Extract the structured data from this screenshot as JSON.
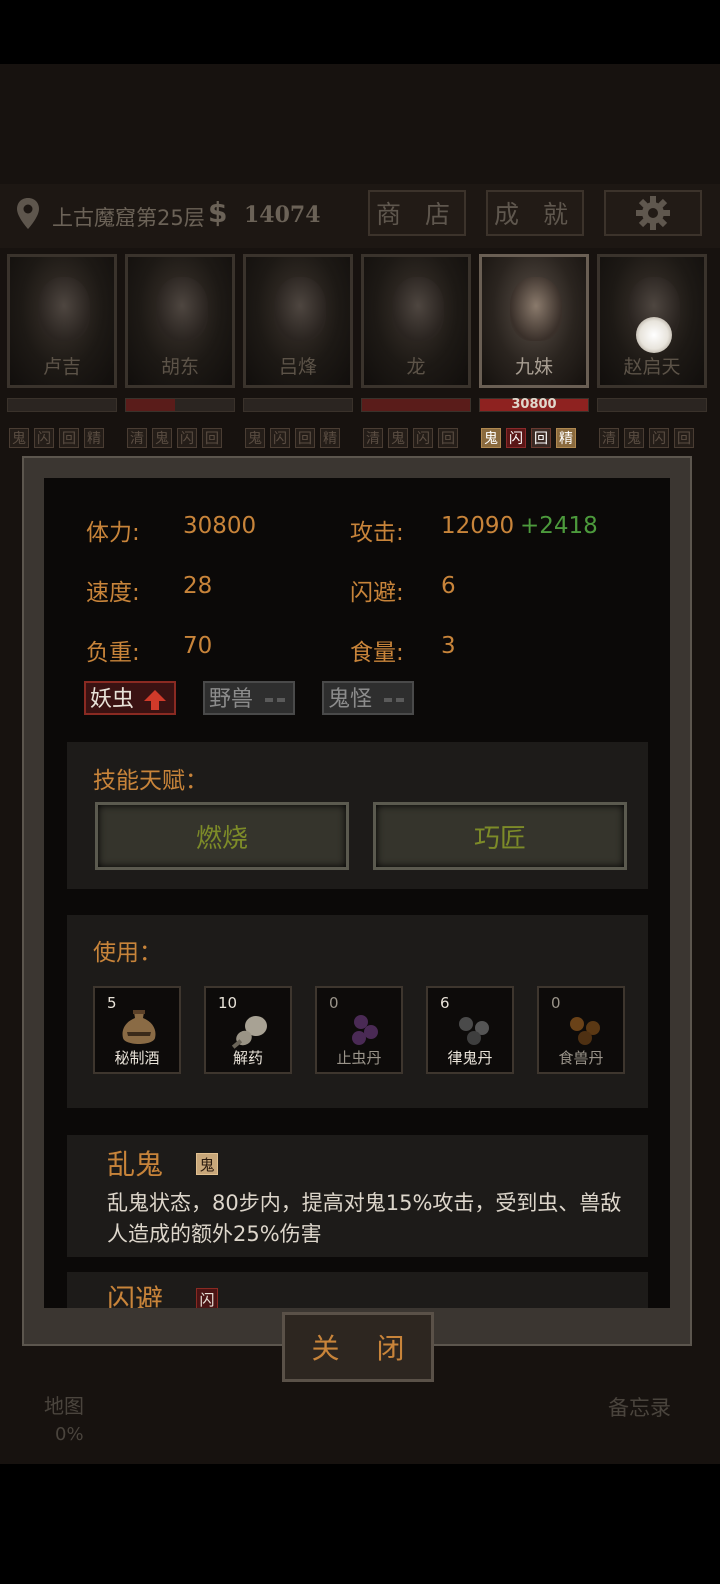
{
  "header": {
    "location": "上古魔窟第25层",
    "money_symbol": "$",
    "money": "14074",
    "shop_label": "商 店",
    "achievements_label": "成 就",
    "settings_icon": "gear-icon"
  },
  "characters": [
    {
      "name": "卢吉",
      "hp_ratio": 0.0,
      "tags": [
        "鬼",
        "闪",
        "回",
        "精"
      ]
    },
    {
      "name": "胡东",
      "hp_ratio": 0.45,
      "tags": [
        "清",
        "鬼",
        "闪",
        "回"
      ]
    },
    {
      "name": "吕烽",
      "hp_ratio": 0.0,
      "tags": [
        "鬼",
        "闪",
        "回",
        "精"
      ]
    },
    {
      "name": "龙",
      "hp_ratio": 1.0,
      "tags": [
        "清",
        "鬼",
        "闪",
        "回"
      ]
    },
    {
      "name": "九妹",
      "hp_ratio": 1.0,
      "hp_text": "30800",
      "tags": [
        "鬼",
        "闪",
        "回",
        "精"
      ],
      "selected": true
    },
    {
      "name": "赵启天",
      "hp_ratio": 0.0,
      "tags": [
        "清",
        "鬼",
        "闪",
        "回"
      ]
    }
  ],
  "stats": {
    "stamina_label": "体力:",
    "stamina": "30800",
    "attack_label": "攻击:",
    "attack": "12090",
    "attack_bonus": "+2418",
    "speed_label": "速度:",
    "speed": "28",
    "dodge_label": "闪避:",
    "dodge": "6",
    "load_label": "负重:",
    "load": "70",
    "food_label": "食量:",
    "food": "3"
  },
  "affinities": [
    {
      "label": "妖虫",
      "state": "up"
    },
    {
      "label": "野兽",
      "state": "neutral"
    },
    {
      "label": "鬼怪",
      "state": "neutral"
    }
  ],
  "talents": {
    "title": "技能天赋：",
    "items": [
      "燃烧",
      "巧匠"
    ]
  },
  "use": {
    "title": "使用：",
    "items": [
      {
        "count": "5",
        "name": "秘制酒"
      },
      {
        "count": "10",
        "name": "解药"
      },
      {
        "count": "0",
        "name": "止虫丹"
      },
      {
        "count": "6",
        "name": "律鬼丹"
      },
      {
        "count": "0",
        "name": "食兽丹"
      }
    ]
  },
  "effects": [
    {
      "title": "乱鬼",
      "badge": "鬼",
      "desc_line1": "乱鬼状态，80步内，提高对鬼15%攻击，受到虫、兽敌",
      "desc_line2": "人造成的额外25%伤害"
    },
    {
      "title": "闪避",
      "badge": "闪"
    }
  ],
  "close_label": "关 闭",
  "bottom": {
    "map_label": "地图",
    "map_progress": "0%",
    "memo_label": "备忘录"
  },
  "colors": {
    "accent": "#c8843a",
    "bonus": "#4c9a3c",
    "talent_text": "#7d8b28",
    "affinity_up": "#d03a2a"
  }
}
